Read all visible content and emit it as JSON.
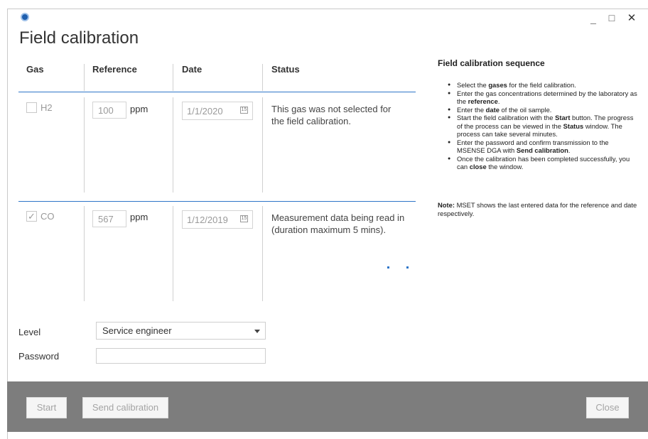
{
  "window": {
    "minimize_glyph": "_",
    "maximize_glyph": "☐",
    "close_glyph": "✕"
  },
  "title": "Field calibration",
  "columns": {
    "gas": "Gas",
    "reference": "Reference",
    "date": "Date",
    "status": "Status"
  },
  "rows": [
    {
      "gas": "H2",
      "checked": false,
      "reference": "100",
      "unit": "ppm",
      "date": "1/1/2020",
      "status": "This gas was not selected for the field calibration."
    },
    {
      "gas": "CO",
      "checked": true,
      "reference": "567",
      "unit": "ppm",
      "date": "1/12/2019",
      "status": "Measurement data being read in (duration maximum 5 mins)."
    }
  ],
  "side_panel": {
    "title": "Field calibration sequence",
    "steps": [
      [
        "Select the ",
        "gases",
        " for the field calibration."
      ],
      [
        "Enter the gas concentrations determined by the laboratory as the ",
        "reference",
        "."
      ],
      [
        "Enter the ",
        "date",
        " of the oil sample."
      ],
      [
        "Start the field calibration with the ",
        "Start",
        " button. The progress of the process can be viewed in the ",
        "Status",
        " window. The process can take several minutes."
      ],
      [
        "Enter the password and confirm transmission to the MSENSE DGA with ",
        "Send calibration",
        "."
      ],
      [
        "Once the calibration has been completed successfully, you can ",
        "close",
        " the window."
      ]
    ],
    "note_label": "Note:",
    "note_text": " MSET shows the last entered data for the reference and date respectively."
  },
  "form": {
    "level_label": "Level",
    "level_value": "Service engineer",
    "password_label": "Password",
    "password_value": ""
  },
  "buttons": {
    "start": "Start",
    "send": "Send calibration",
    "close": "Close"
  },
  "colors": {
    "accent": "#2e75c8",
    "footer": "#7d7d7d"
  }
}
